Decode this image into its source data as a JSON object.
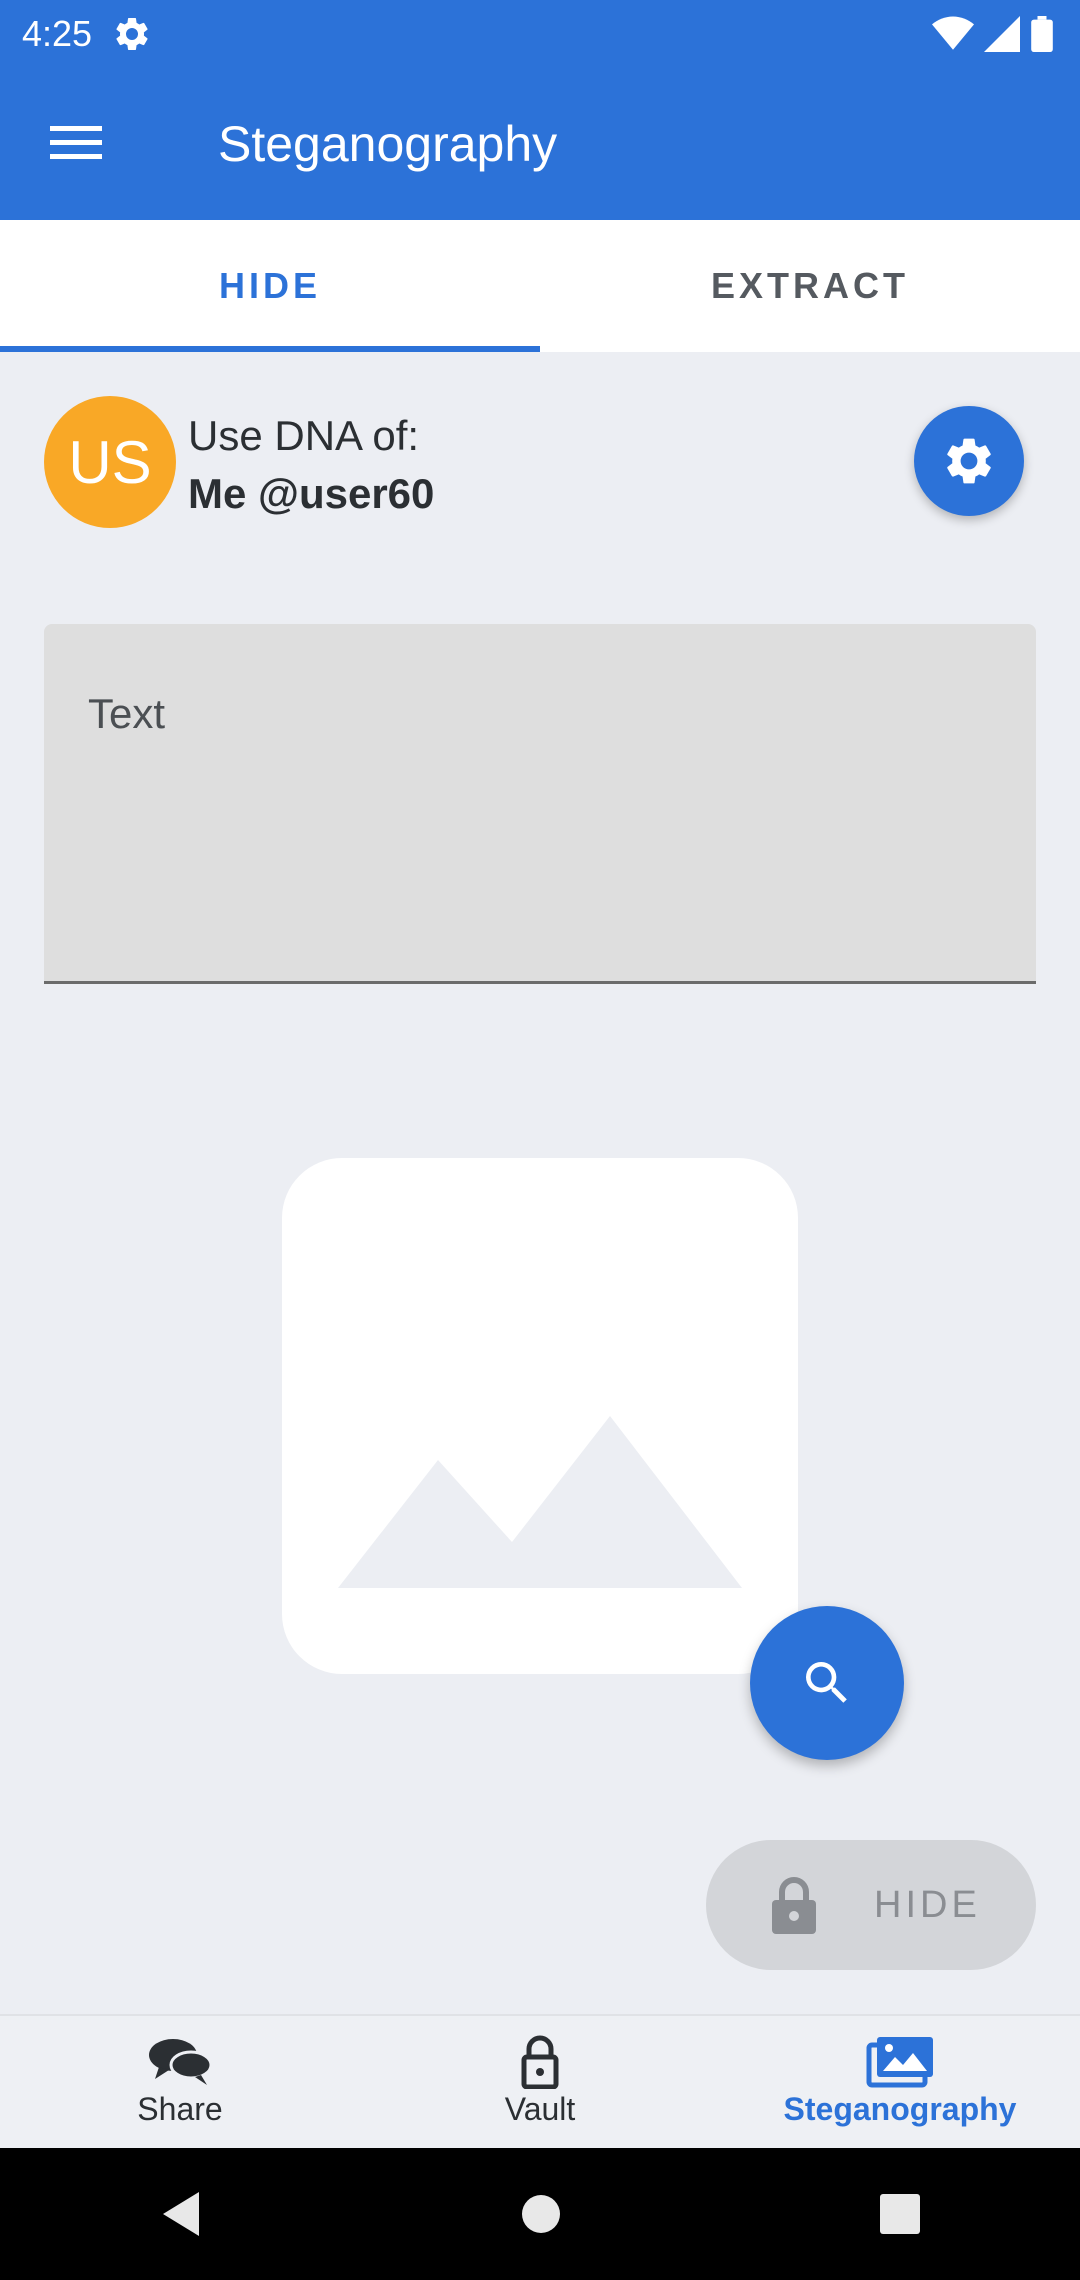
{
  "status_bar": {
    "time": "4:25"
  },
  "app_bar": {
    "title": "Steganography"
  },
  "tabs": [
    {
      "label": "HIDE",
      "selected": true
    },
    {
      "label": "EXTRACT",
      "selected": false
    }
  ],
  "dna": {
    "avatar_initials": "US",
    "label": "Use DNA of:",
    "user": "Me @user60"
  },
  "text_field": {
    "label": "Text",
    "value": ""
  },
  "hide_button": {
    "label": "HIDE",
    "enabled": false
  },
  "bottom_nav": {
    "items": [
      {
        "label": "Share",
        "icon": "chat-bubbles-icon",
        "active": false
      },
      {
        "label": "Vault",
        "icon": "lock-icon",
        "active": false
      },
      {
        "label": "Steganography",
        "icon": "images-icon",
        "active": true
      }
    ]
  },
  "colors": {
    "primary": "#2c72d8",
    "avatar": "#f9a826",
    "background": "#eceef3"
  }
}
